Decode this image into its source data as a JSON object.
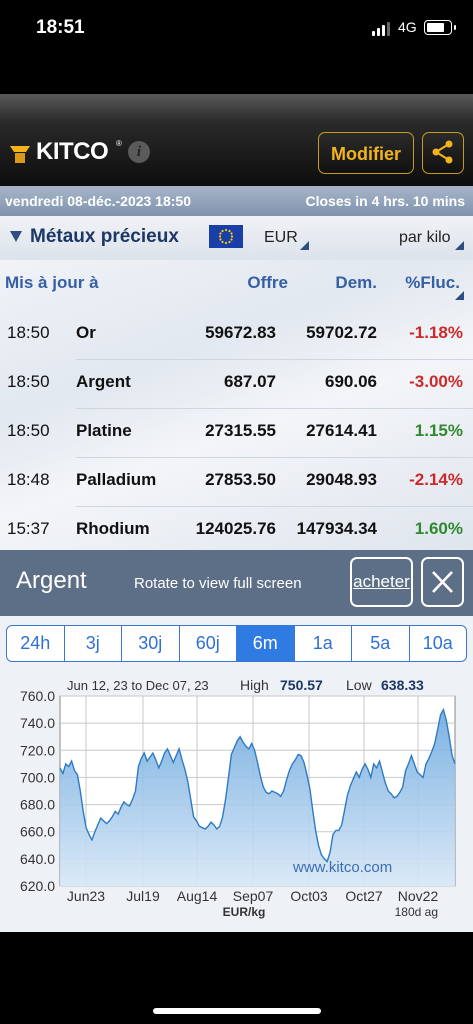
{
  "status_bar": {
    "time": "18:51",
    "network": "4G"
  },
  "header": {
    "logo_text": "KITCO",
    "logo_reg": "®",
    "info_label": "i",
    "modify_label": "Modifier"
  },
  "date_bar": {
    "datetime": "vendredi 08-déc.-2023 18:50",
    "closes": "Closes in 4 hrs. 10 mins"
  },
  "filters": {
    "category": "Métaux précieux",
    "currency": "EUR",
    "unit": "par kilo"
  },
  "table": {
    "headers": [
      "Mis à jour à",
      "Offre",
      "Dem.",
      "%Fluc."
    ],
    "rows": [
      {
        "time": "18:50",
        "name": "Or",
        "offre": "59672.83",
        "dem": "59702.72",
        "fluc": "-1.18%",
        "dir": "neg"
      },
      {
        "time": "18:50",
        "name": "Argent",
        "offre": "687.07",
        "dem": "690.06",
        "fluc": "-3.00%",
        "dir": "neg"
      },
      {
        "time": "18:50",
        "name": "Platine",
        "offre": "27315.55",
        "dem": "27614.41",
        "fluc": "1.15%",
        "dir": "pos"
      },
      {
        "time": "18:48",
        "name": "Palladium",
        "offre": "27853.50",
        "dem": "29048.93",
        "fluc": "-2.14%",
        "dir": "neg"
      },
      {
        "time": "15:37",
        "name": "Rhodium",
        "offre": "124025.76",
        "dem": "147934.34",
        "fluc": "1.60%",
        "dir": "pos"
      }
    ]
  },
  "panel": {
    "title": "Argent",
    "rotate_hint": "Rotate to view full screen",
    "buy_label": "acheter"
  },
  "range_tabs": [
    "24h",
    "3j",
    "30j",
    "60j",
    "6m",
    "1a",
    "5a",
    "10a"
  ],
  "active_tab": "6m",
  "colors": {
    "accent": "#2f7be2",
    "gold": "#f3b41b",
    "negative": "#cc2a2a",
    "positive": "#2f8a2f"
  },
  "chart_data": {
    "type": "area",
    "range_text": "Jun 12, 23 to Dec 07, 23",
    "high_label": "High",
    "high_value": "750.57",
    "low_label": "Low",
    "low_value": "638.33",
    "ylim": [
      620,
      760
    ],
    "y_ticks": [
      "760.0",
      "740.0",
      "720.0",
      "700.0",
      "680.0",
      "660.0",
      "640.0",
      "620.0"
    ],
    "x_ticks": [
      "Jun23",
      "Jul19",
      "Aug14",
      "Sep07",
      "Oct03",
      "Oct27",
      "Nov22"
    ],
    "xlabel": "EUR/kg",
    "days_label": "180d ag",
    "watermark": "www.kitco.com",
    "grid": true,
    "values": [
      707,
      703,
      710,
      708,
      712,
      705,
      702,
      690,
      675,
      663,
      658,
      654,
      660,
      665,
      670,
      668,
      666,
      668,
      671,
      675,
      673,
      678,
      682,
      680,
      679,
      684,
      690,
      708,
      714,
      718,
      712,
      715,
      718,
      713,
      707,
      712,
      718,
      721,
      716,
      711,
      716,
      721,
      713,
      706,
      697,
      684,
      671,
      668,
      664,
      663,
      662,
      664,
      667,
      665,
      662,
      664,
      671,
      684,
      700,
      717,
      722,
      727,
      730,
      726,
      723,
      721,
      725,
      720,
      711,
      701,
      693,
      689,
      688,
      690,
      689,
      688,
      686,
      690,
      698,
      705,
      710,
      713,
      717,
      716,
      711,
      702,
      692,
      676,
      661,
      650,
      643,
      640,
      638,
      645,
      658,
      661,
      661,
      665,
      676,
      687,
      694,
      699,
      704,
      700,
      706,
      710,
      706,
      700,
      710,
      707,
      712,
      704,
      696,
      690,
      688,
      685,
      686,
      689,
      693,
      705,
      710,
      716,
      710,
      704,
      702,
      700,
      710,
      714,
      719,
      725,
      735,
      746,
      750,
      742,
      730,
      716,
      710
    ]
  }
}
